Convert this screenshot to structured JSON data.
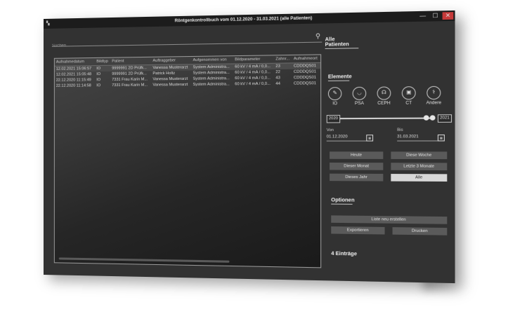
{
  "window": {
    "title": "Röntgenkontrollbuch vom 01.12.2020 - 31.03.2021 (alle Patienten)",
    "minimize": "—",
    "maximize": "☐",
    "close": "✕"
  },
  "search": {
    "placeholder": "Suchen..."
  },
  "table": {
    "columns": [
      "Aufnahmedatum",
      "Bildtyp",
      "Patient",
      "Auftraggeber",
      "Aufgenommen von",
      "Bildparameter",
      "Zahnr...",
      "Aufnahmeort"
    ],
    "rows": [
      [
        "12.02.2021 15:06:57",
        "IO",
        "9999991  2D Prüfk...",
        "Vanessa Musterarzt",
        "System Administra...",
        "60 kV / 4 mA / 0,0...",
        "23",
        "CDDDQS01"
      ],
      [
        "12.02.2021 15:05:48",
        "IO",
        "9999991  2D Prüfk...",
        "Patrick Holtz",
        "System Administra...",
        "60 kV / 4 mA / 0,0...",
        "22",
        "CDDDQS01"
      ],
      [
        "22.12.2020 11:15:49",
        "IO",
        "7331 Frau Karin M...",
        "Vanessa Musterarzt",
        "System Administra...",
        "60 kV / 4 mA / 0,0...",
        "43",
        "CDDDQS01"
      ],
      [
        "22.12.2020 11:14:58",
        "IO",
        "7331 Frau Karin M...",
        "Vanessa Musterarzt",
        "System Administra...",
        "60 kV / 4 mA / 0,0...",
        "44",
        "CDDDQS01"
      ]
    ]
  },
  "right": {
    "all_patients": "Alle Patienten",
    "elements_title": "Elemente",
    "elements": [
      {
        "label": "IO",
        "icon": "tooth-io-icon",
        "glyph": "✎"
      },
      {
        "label": "PSA",
        "icon": "panorama-icon",
        "glyph": "◡"
      },
      {
        "label": "CEPH",
        "icon": "ceph-icon",
        "glyph": "☊"
      },
      {
        "label": "CT",
        "icon": "ct-icon",
        "glyph": "▣"
      },
      {
        "label": "Andere",
        "icon": "other-icon",
        "glyph": "⚕"
      }
    ],
    "year_from": "2020",
    "year_to": "2021",
    "von_label": "Von",
    "von_value": "01.12.2020",
    "bis_label": "Bis",
    "bis_value": "31.03.2021",
    "cal_glyph": "▦",
    "buttons": {
      "heute": "Heute",
      "diese_woche": "Diese Woche",
      "dieser_monat": "Dieser Monat",
      "letzte_3_monate": "Letzte 3 Monate",
      "dieses_jahr": "Dieses Jahr",
      "alle": "Alle"
    },
    "options_title": "Optionen",
    "liste_neu": "Liste neu erstellen",
    "exportieren": "Exportieren",
    "drucken": "Drucken",
    "count": "4 Einträge"
  }
}
